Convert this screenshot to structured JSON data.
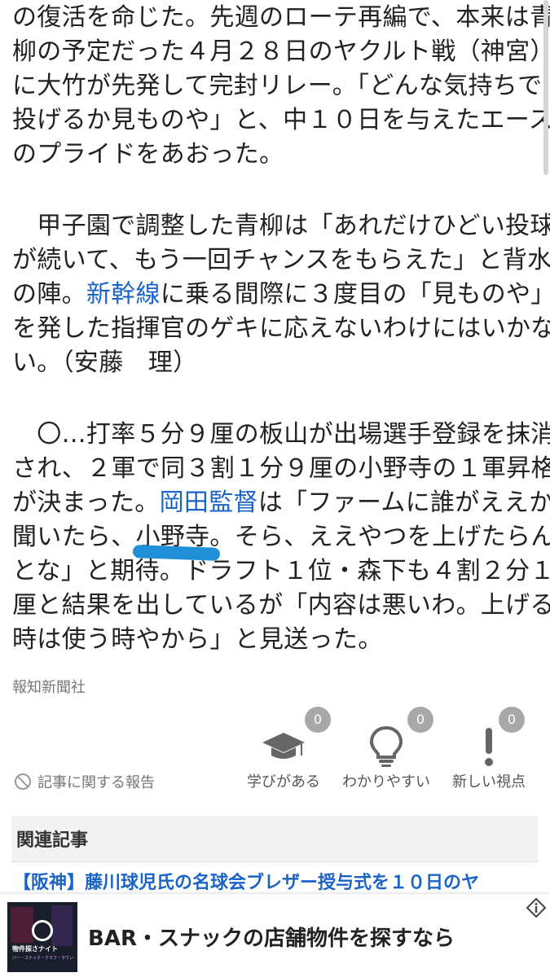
{
  "article": {
    "lines": [
      [
        "の復活を命じた。先週のローテ再編で、本来は青"
      ],
      [
        "柳の予定だった４月２８日のヤクルト戦（神宮）"
      ],
      [
        "に大竹が先発して完封リレー。「どんな気持ちで"
      ],
      [
        "投げるか見ものや」と、中１０日を与えたエース"
      ],
      [
        "のプライドをあおった。"
      ],
      [
        "　甲子園で調整した青柳は「あれだけひどい投球"
      ],
      [
        "が続いて、もう一回チャンスをもらえた」と背水"
      ],
      [
        "の陣。",
        "新幹線",
        "に乗る間際に３度目の「見ものや」"
      ],
      [
        "を発した指揮官のゲキに応えないわけにはいかな"
      ],
      [
        "い。（安藤　理）"
      ],
      [
        "　〇…打率５分９厘の板山が出場選手登録を抹消"
      ],
      [
        "され、２軍で同３割１分９厘の小野寺の１軍昇格"
      ],
      [
        "が決まった。",
        "岡田監督",
        "は「ファームに誰がええか"
      ],
      [
        "聞いたら、小野寺。そら、ええやつを上げたらん"
      ],
      [
        "とな」と期待。ドラフト１位・森下も４割２分１"
      ],
      [
        "厘と結果を出しているが「内容は悪いわ。上げる"
      ],
      [
        "時は使う時やから」と見送った。"
      ]
    ]
  },
  "source": "報知新聞社",
  "report_label": "記事に関する報告",
  "reactions": [
    {
      "icon": "graduation-cap-icon",
      "label": "学びがある",
      "count": "0"
    },
    {
      "icon": "lightbulb-icon",
      "label": "わかりやすい",
      "count": "0"
    },
    {
      "icon": "exclamation-icon",
      "label": "新しい視点",
      "count": "0"
    }
  ],
  "related": {
    "header": "関連記事",
    "item": "【阪神】藤川球児氏の名球会ブレザー授与式を１０日のヤ"
  },
  "ad": {
    "title": "BAR・スナックの店舗物件を探すなら",
    "thumb_title": "物件探さナイト",
    "thumb_sub": "バー・スナック・クラブ・ラウンジ ナイト店舗物件お探しの方、必見!"
  },
  "colors": {
    "link": "#1a64c8",
    "marker": "#1f90d8",
    "badge": "#a8a8a8"
  }
}
